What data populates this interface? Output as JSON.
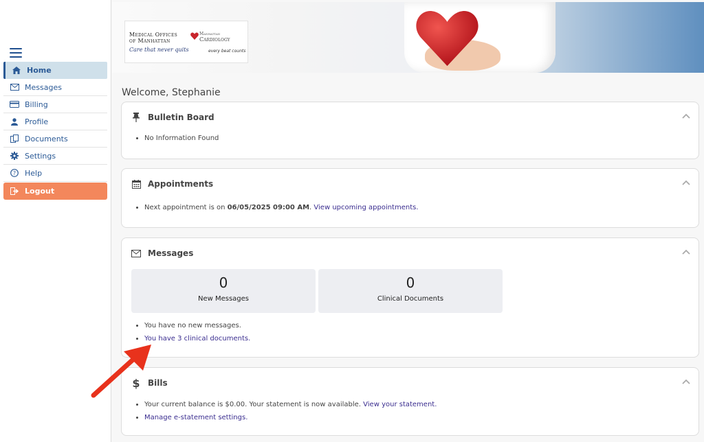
{
  "sidebar": {
    "items": [
      {
        "label": "Home",
        "icon": "home-icon"
      },
      {
        "label": "Messages",
        "icon": "envelope-icon"
      },
      {
        "label": "Billing",
        "icon": "credit-card-icon"
      },
      {
        "label": "Profile",
        "icon": "user-icon"
      },
      {
        "label": "Documents",
        "icon": "documents-icon"
      },
      {
        "label": "Settings",
        "icon": "gear-icon"
      },
      {
        "label": "Help",
        "icon": "help-icon"
      },
      {
        "label": "Logout",
        "icon": "logout-icon"
      }
    ]
  },
  "header": {
    "logo_line1": "Medical Offices",
    "logo_line2": "of Manhattan",
    "logo_tagline": "Care that never quits",
    "cardio_line1": "Manhattan",
    "cardio_line2": "Cardiology",
    "cardio_tagline": "every beat counts"
  },
  "welcome": "Welcome, Stephanie",
  "bulletin": {
    "title": "Bulletin Board",
    "item": "No Information Found"
  },
  "appointments": {
    "title": "Appointments",
    "prefix": "Next appointment is on ",
    "datetime": "06/05/2025 09:00 AM",
    "suffix": ". ",
    "link": "View upcoming appointments."
  },
  "messages": {
    "title": "Messages",
    "new_count": "0",
    "new_label": "New Messages",
    "clinical_count": "0",
    "clinical_label": "Clinical Documents",
    "line1": "You have no new messages.",
    "line2_link": "You have 3 clinical documents."
  },
  "bills": {
    "title": "Bills",
    "line1_text": "Your current balance is $0.00. Your statement is now available. ",
    "line1_link": "View your statement.",
    "line2_link": "Manage e-statement settings."
  },
  "colors": {
    "accent": "#2b5a96",
    "logout": "#f3875c",
    "active_bg": "#cfe0ea",
    "link": "#3a2d8f",
    "arrow": "#e8321c"
  }
}
